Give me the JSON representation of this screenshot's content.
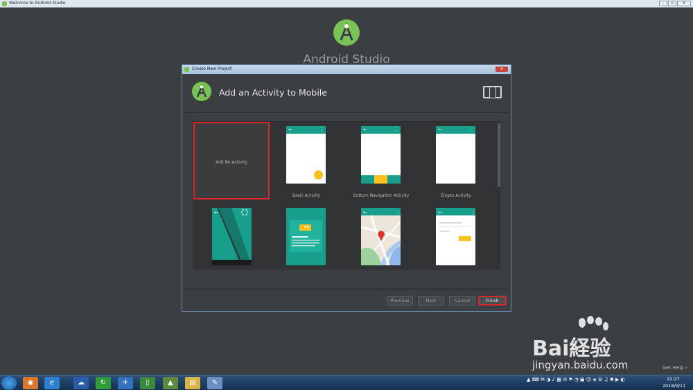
{
  "window": {
    "title": "Welcome to Android Studio"
  },
  "welcome": {
    "app_name": "Android Studio",
    "get_help": "Get Help ›"
  },
  "dialog": {
    "title": "Create New Project",
    "heading": "Add an Activity to Mobile",
    "templates": [
      {
        "label": "Add No Activity",
        "selected": true
      },
      {
        "label": "Basic Activity"
      },
      {
        "label": "Bottom Navigation Activity"
      },
      {
        "label": "Empty Activity"
      },
      {
        "label": ""
      },
      {
        "label": ""
      },
      {
        "label": ""
      },
      {
        "label": ""
      }
    ],
    "buttons": {
      "previous": "Previous",
      "next": "Next",
      "cancel": "Cancel",
      "finish": "Finish"
    },
    "ad_badge": "Ad"
  },
  "taskbar": {
    "time": "22:27",
    "date": "2018/9/11"
  },
  "watermark": {
    "brand": "Bai経验",
    "url": "jingyan.baidu.com"
  },
  "colors": {
    "accent_teal": "#189f8c",
    "fab_yellow": "#f9c01f",
    "selection_red": "#d9262b"
  }
}
